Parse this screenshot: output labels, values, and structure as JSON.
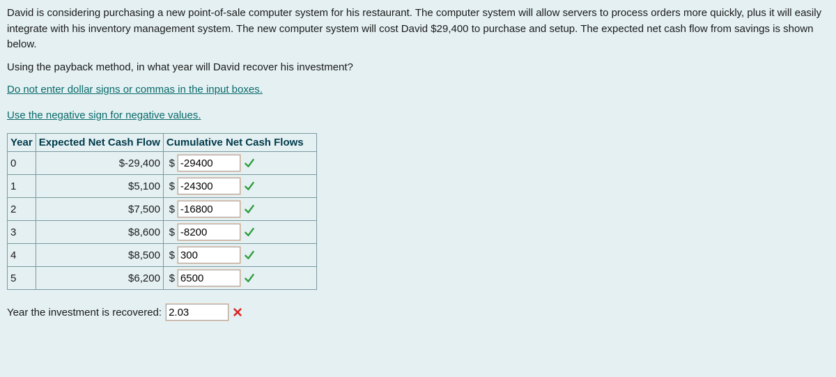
{
  "para1": "David is considering purchasing a new point-of-sale computer system for his restaurant. The computer system will allow servers to process orders more quickly, plus it will easily integrate with his inventory management system. The new computer system will cost David $29,400 to purchase and setup. The expected net cash flow from savings is shown below.",
  "para2": "Using the payback method, in what year will David recover his investment?",
  "instr1": "Do not enter dollar signs or commas in the input boxes.",
  "instr2": "Use the negative sign for negative values.",
  "headers": {
    "year": "Year",
    "cash": "Expected Net Cash Flow",
    "cum": "Cumulative Net Cash Flows"
  },
  "currency": "$",
  "rows": [
    {
      "year": "0",
      "cash": "$-29,400",
      "cum": "-29400",
      "mark": "check"
    },
    {
      "year": "1",
      "cash": "$5,100",
      "cum": "-24300",
      "mark": "check"
    },
    {
      "year": "2",
      "cash": "$7,500",
      "cum": "-16800",
      "mark": "check"
    },
    {
      "year": "3",
      "cash": "$8,600",
      "cum": "-8200",
      "mark": "check"
    },
    {
      "year": "4",
      "cash": "$8,500",
      "cum": "300",
      "mark": "check"
    },
    {
      "year": "5",
      "cash": "$6,200",
      "cum": "6500",
      "mark": "check"
    }
  ],
  "answer": {
    "label": "Year the investment is recovered:",
    "value": "2.03",
    "mark": "cross"
  },
  "chart_data": {
    "type": "table",
    "title": "Payback method cash flows",
    "columns": [
      "Year",
      "Expected Net Cash Flow",
      "Cumulative Net Cash Flows"
    ],
    "rows": [
      [
        0,
        -29400,
        -29400
      ],
      [
        1,
        5100,
        -24300
      ],
      [
        2,
        7500,
        -16800
      ],
      [
        3,
        8600,
        -8200
      ],
      [
        4,
        8500,
        300
      ],
      [
        5,
        6200,
        6500
      ]
    ]
  }
}
